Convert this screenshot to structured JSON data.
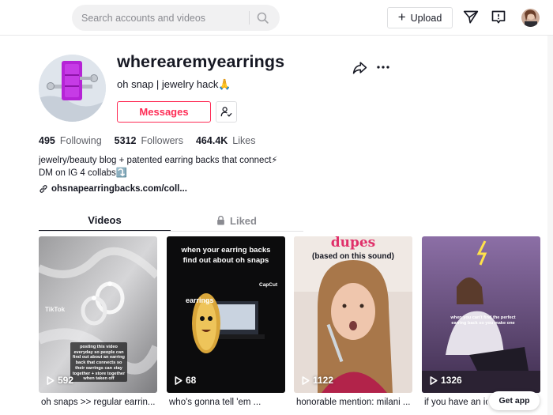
{
  "search": {
    "placeholder": "Search accounts and videos"
  },
  "header": {
    "upload_label": "Upload"
  },
  "profile": {
    "username": "wherearemyearrings",
    "nickname": "oh snap | jewelry hack🙏",
    "messages_label": "Messages",
    "stats": [
      {
        "value": "495",
        "label": "Following"
      },
      {
        "value": "5312",
        "label": "Followers"
      },
      {
        "value": "464.4K",
        "label": "Likes"
      }
    ],
    "bio_line1": "jewelry/beauty blog + patented earring backs that connect⚡",
    "bio_line2": "DM on IG 4 collabs⤵️",
    "link": "ohsnapearringbacks.com/coll..."
  },
  "tabs": {
    "videos": "Videos",
    "liked": "Liked"
  },
  "videos": [
    {
      "views": "592",
      "title": "oh snaps >> regular earrin...",
      "overlay": "posting this video everyday so people can find out about an earring back that connects so their earrings can stay together + store together when taken off",
      "watermark": "TikTok"
    },
    {
      "views": "68",
      "title": "who's gonna tell 'em ...",
      "overlay": "when your earring backs find out about oh snaps",
      "badge": "CapCut",
      "caption": "earrings"
    },
    {
      "views": "1122",
      "title": "honorable mention: milani ...",
      "overlay": "dupes",
      "overlay2": "(based on this sound)"
    },
    {
      "views": "1326",
      "title": "if you have an ic",
      "overlay": "when you can't find the perfect earring back so you make one"
    }
  ],
  "get_app": "Get app",
  "colors": {
    "accent": "#fe2c55",
    "text": "#161823",
    "muted": "#8a8b91"
  }
}
